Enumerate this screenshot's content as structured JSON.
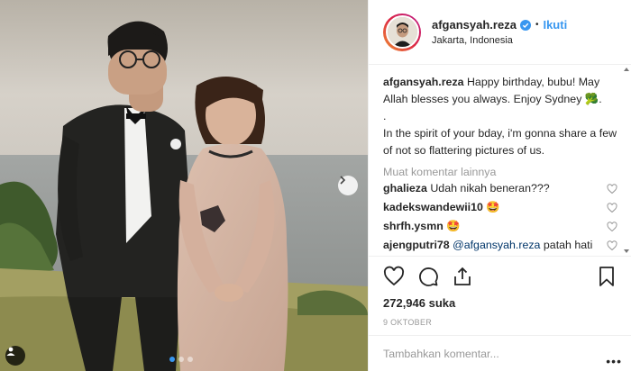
{
  "post": {
    "username": "afgansyah.reza",
    "separator": "•",
    "follow_label": "Ikuti",
    "location": "Jakarta, Indonesia",
    "caption_line1": "Happy birthday, bubu! May Allah blesses you always. Enjoy Sydney 🥦.",
    "caption_line2": ".",
    "caption_line3": "In the spirit of your bday, i'm gonna share a few of not so flattering pictures of us.",
    "load_more": "Muat komentar lainnya",
    "comments": [
      {
        "user": "ghalieza",
        "text": "Udah nikah beneran???",
        "mention": ""
      },
      {
        "user": "kadekswandewii10",
        "text": "🤩",
        "mention": ""
      },
      {
        "user": "shrfh.ysmn",
        "text": "🤩",
        "mention": ""
      },
      {
        "user": "ajengputri78",
        "text": "patah hati gw bang",
        "mention": "@afgansyah.reza"
      }
    ],
    "likes": "272,946 suka",
    "date": "9 OKTOBER",
    "comment_placeholder": "Tambahkan komentar...",
    "more_menu": "•••"
  },
  "carousel": {
    "slide_count": 3,
    "active_index": 0
  },
  "colors": {
    "accent": "#3897f0",
    "text": "#262626",
    "muted": "#999999"
  },
  "icons": [
    "verified-badge-icon",
    "heart-icon",
    "comment-icon",
    "share-icon",
    "bookmark-icon",
    "chevron-right-icon",
    "person-tag-icon"
  ]
}
